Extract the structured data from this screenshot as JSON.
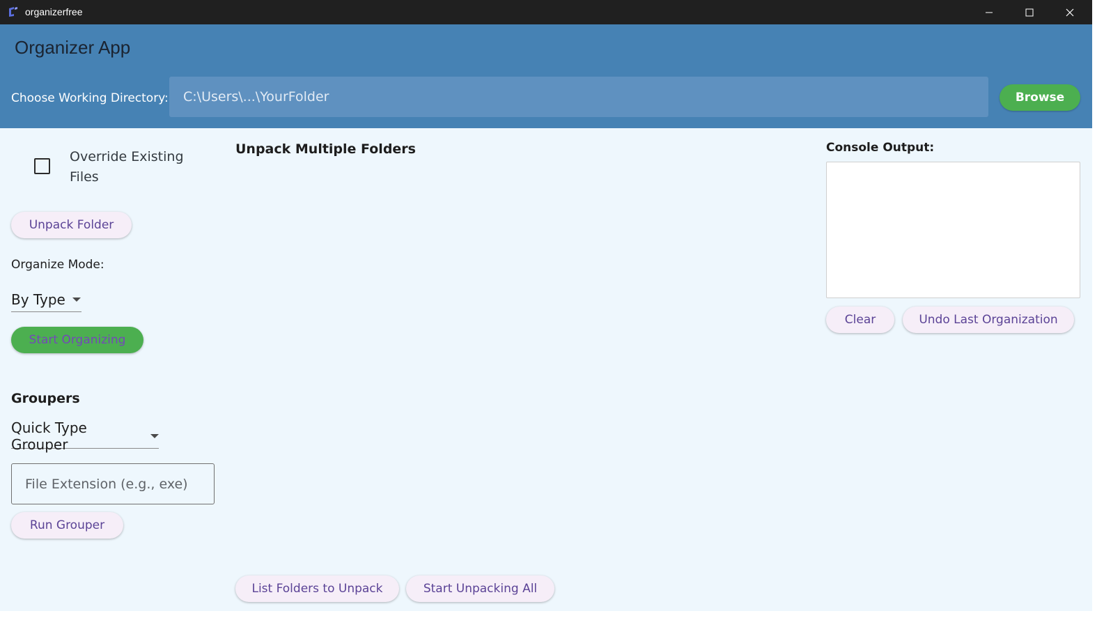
{
  "window": {
    "title": "organizerfree"
  },
  "header": {
    "app_title": "Organizer App",
    "dir_label": "Choose Working Directory:",
    "dir_placeholder": "C:\\Users\\...\\YourFolder",
    "browse_label": "Browse"
  },
  "left": {
    "override_label": "Override Existing Files",
    "override_checked": false,
    "unpack_folder_label": "Unpack Folder",
    "organize_mode_label": "Organize Mode:",
    "organize_mode_value": "By Type",
    "start_organizing_label": "Start Organizing",
    "groupers_title": "Groupers",
    "grouper_value": "Quick Type Grouper",
    "extension_placeholder": "File Extension (e.g., exe)",
    "run_grouper_label": "Run Grouper"
  },
  "center": {
    "title": "Unpack Multiple Folders",
    "list_folders_label": "List Folders to Unpack",
    "start_unpacking_label": "Start Unpacking All"
  },
  "right": {
    "console_label": "Console Output:",
    "console_text": "",
    "clear_label": "Clear",
    "undo_label": "Undo Last Organization"
  },
  "colors": {
    "header_bg": "#4682b4",
    "body_bg": "#eef7fd",
    "green_accent": "#4caf50",
    "button_text": "#5b4396"
  },
  "icons": [
    "app-icon",
    "minimize-icon",
    "maximize-icon",
    "close-icon",
    "chevron-down-icon"
  ]
}
